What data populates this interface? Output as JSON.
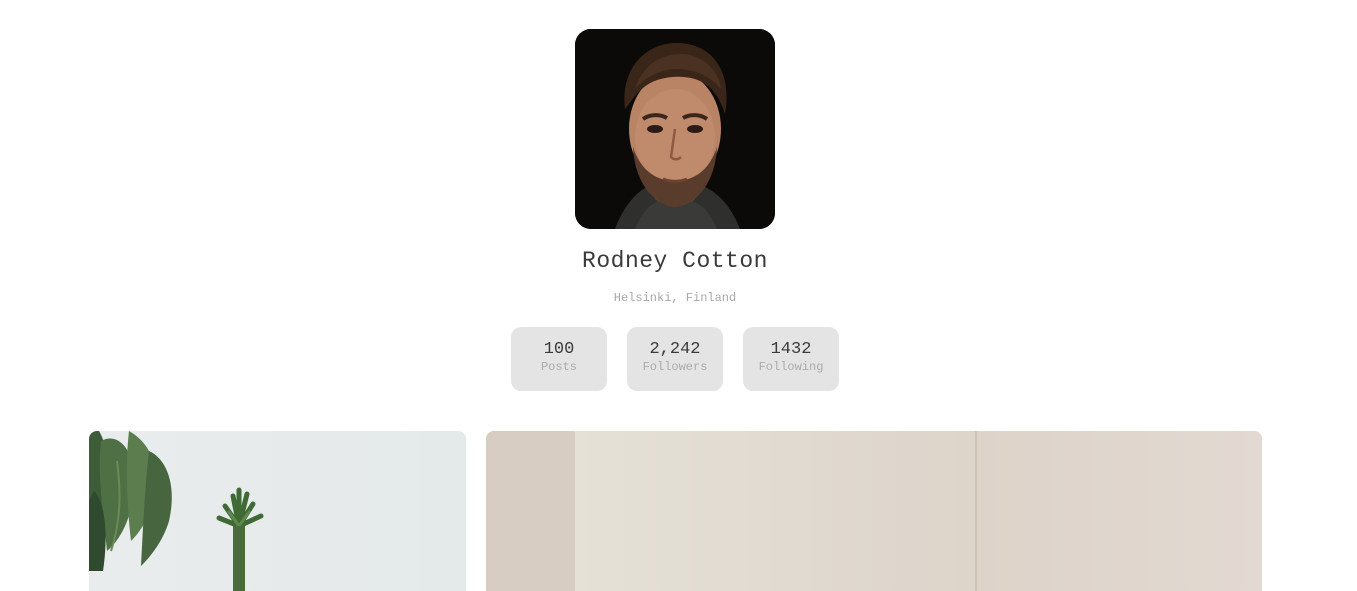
{
  "profile": {
    "name": "Rodney Cotton",
    "location": "Helsinki, Finland"
  },
  "stats": [
    {
      "value": "100",
      "label": "Posts"
    },
    {
      "value": "2,242",
      "label": "Followers"
    },
    {
      "value": "1432",
      "label": "Following"
    }
  ],
  "gallery": {
    "photos": [
      "plant-photo",
      "room-photo"
    ]
  },
  "colors": {
    "stat_background": "#e4e4e4",
    "name_text": "#3a3a3a",
    "muted_text": "#a8a8a8"
  }
}
